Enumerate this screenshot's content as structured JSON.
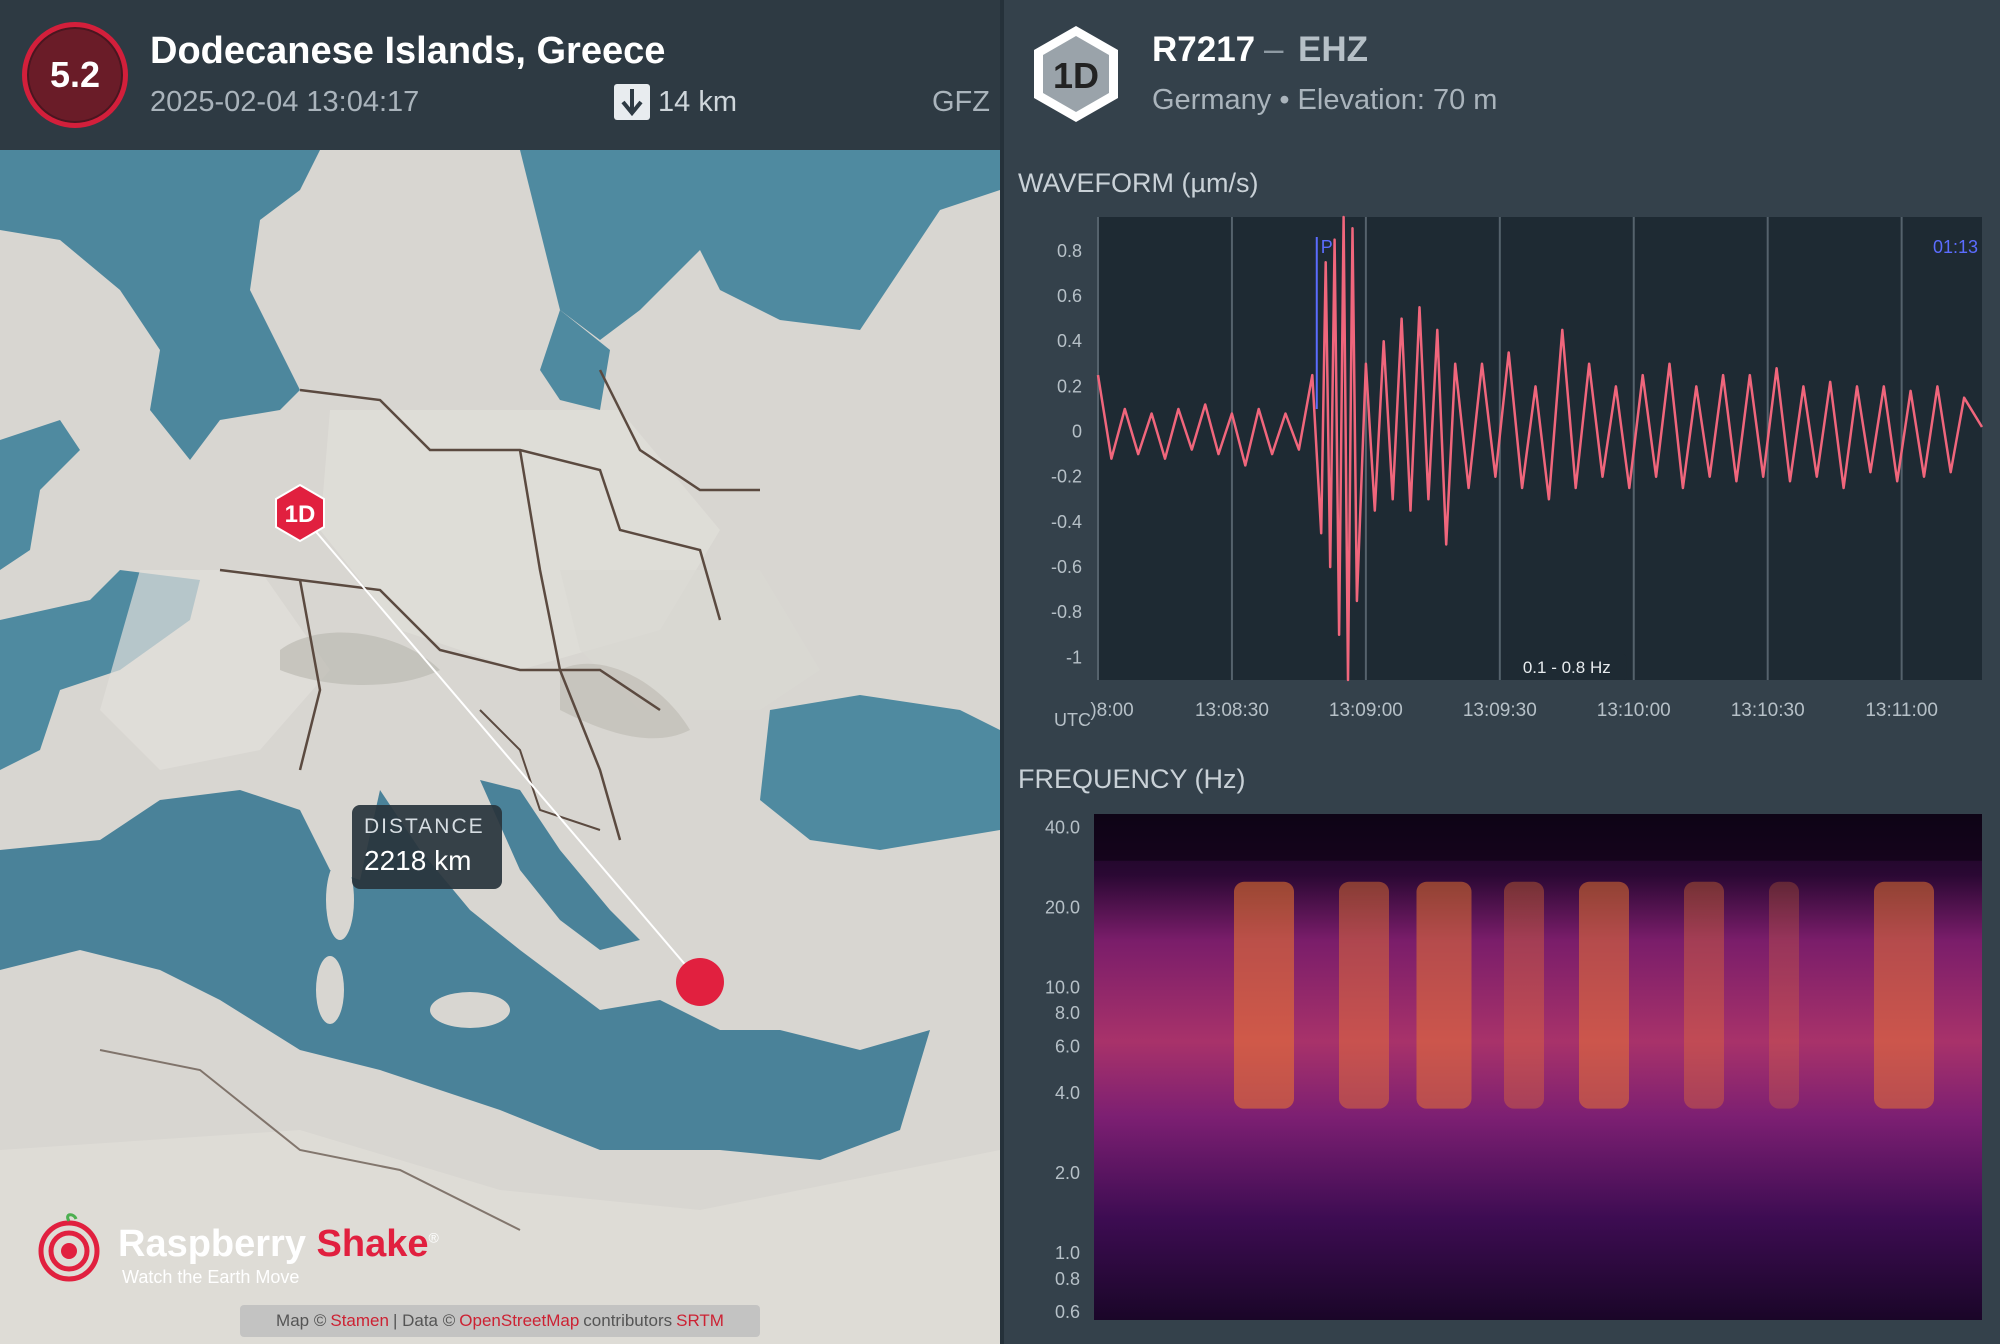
{
  "event": {
    "magnitude": "5.2",
    "title": "Dodecanese Islands, Greece",
    "datetime": "2025-02-04 13:04:17",
    "depth": "14 km",
    "source": "GFZ",
    "depth_icon": "arrow-down-icon"
  },
  "map": {
    "station_marker": "1D",
    "distance_label": "DISTANCE",
    "distance_value": "2218 km",
    "brand_name_1": "Raspberry",
    "brand_name_2": "Shake",
    "brand_reg": "®",
    "tagline": "Watch the Earth Move",
    "attribution": {
      "prefix": "Map ©",
      "link1": "Stamen",
      "data": "| Data ©",
      "link2": "OpenStreetMap",
      "contributors": "contributors",
      "link3": "SRTM"
    },
    "colors": {
      "sea": "#4f8aa0",
      "land": "#d7d5d0",
      "accent": "#e1203f"
    }
  },
  "station": {
    "hex_label": "1D",
    "code": "R7217",
    "separator": "–",
    "channel": "EHZ",
    "country": "Germany",
    "dot": "•",
    "elevation": "Elevation: 70 m"
  },
  "waveform": {
    "title": "WAVEFORM (µm/s)",
    "utc_label": "UTC",
    "filter_label": "0.1 - 0.8 Hz",
    "p_marker": "P",
    "corner_time": "01:13",
    "line_color": "#f0667c"
  },
  "frequency": {
    "title": "FREQUENCY (Hz)"
  },
  "chart_data": [
    {
      "type": "line",
      "title": "WAVEFORM (µm/s)",
      "xlabel": "UTC",
      "ylabel": "",
      "y_ticks": [
        "0.8",
        "0.6",
        "0.4",
        "0.2",
        "0",
        "-0.2",
        "-0.4",
        "-0.6",
        "-0.8",
        "-1"
      ],
      "y_tick_values": [
        0.8,
        0.6,
        0.4,
        0.2,
        0,
        -0.2,
        -0.4,
        -0.6,
        -0.8,
        -1
      ],
      "x_ticks": [
        ")8:00",
        "13:08:30",
        "13:09:00",
        "13:09:30",
        "13:10:00",
        "13:10:30",
        "13:11:00"
      ],
      "x_tick_seconds": [
        0,
        30,
        60,
        90,
        120,
        150,
        180
      ],
      "xlim_seconds": [
        0,
        198
      ],
      "ylim": [
        -1.1,
        0.95
      ],
      "p_arrival_seconds": 49,
      "series": [
        {
          "x_seconds": [
            0,
            3,
            6,
            9,
            12,
            15,
            18,
            21,
            24,
            27,
            30,
            33,
            36,
            39,
            42,
            45,
            48,
            50,
            51,
            52,
            53,
            54,
            55,
            56,
            57,
            58,
            60,
            62,
            64,
            66,
            68,
            70,
            72,
            74,
            76,
            78,
            80,
            83,
            86,
            89,
            92,
            95,
            98,
            101,
            104,
            107,
            110,
            113,
            116,
            119,
            122,
            125,
            128,
            131,
            134,
            137,
            140,
            143,
            146,
            149,
            152,
            155,
            158,
            161,
            164,
            167,
            170,
            173,
            176,
            179,
            182,
            185,
            188,
            191,
            194,
            198
          ],
          "values": [
            0.25,
            -0.12,
            0.1,
            -0.1,
            0.08,
            -0.12,
            0.1,
            -0.08,
            0.12,
            -0.1,
            0.08,
            -0.15,
            0.1,
            -0.1,
            0.08,
            -0.08,
            0.25,
            -0.45,
            0.75,
            -0.6,
            0.85,
            -0.9,
            0.95,
            -1.1,
            0.9,
            -0.75,
            0.3,
            -0.35,
            0.4,
            -0.3,
            0.5,
            -0.35,
            0.55,
            -0.3,
            0.45,
            -0.5,
            0.3,
            -0.25,
            0.3,
            -0.2,
            0.35,
            -0.25,
            0.2,
            -0.3,
            0.45,
            -0.25,
            0.3,
            -0.2,
            0.2,
            -0.25,
            0.25,
            -0.2,
            0.3,
            -0.25,
            0.2,
            -0.2,
            0.25,
            -0.22,
            0.25,
            -0.2,
            0.28,
            -0.22,
            0.2,
            -0.2,
            0.22,
            -0.25,
            0.2,
            -0.18,
            0.2,
            -0.22,
            0.18,
            -0.2,
            0.2,
            -0.18,
            0.15,
            0.02
          ]
        }
      ]
    },
    {
      "type": "heatmap",
      "title": "FREQUENCY (Hz)",
      "ylabel": "",
      "y_ticks": [
        "40.0",
        "20.0",
        "10.0",
        "8.0",
        "6.0",
        "4.0",
        "2.0",
        "1.0",
        "0.8",
        "0.6"
      ],
      "y_tick_values": [
        40,
        20,
        10,
        8,
        6,
        4,
        2,
        1,
        0.8,
        0.6
      ],
      "y_scale": "log",
      "ylim": [
        0.56,
        45
      ],
      "colormap": "inferno"
    }
  ]
}
